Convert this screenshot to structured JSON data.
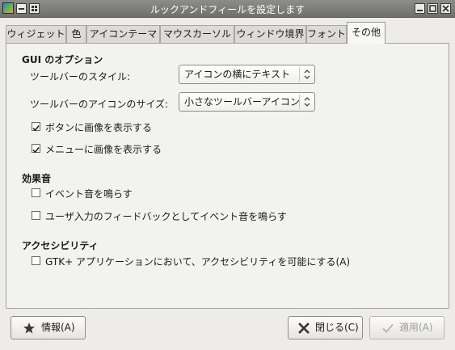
{
  "window": {
    "title": "ルックアンドフィールを設定します"
  },
  "tabs": [
    {
      "label": "ウィジェット"
    },
    {
      "label": "色"
    },
    {
      "label": "アイコンテーマ"
    },
    {
      "label": "マウスカーソル"
    },
    {
      "label": "ウィンドウ境界"
    },
    {
      "label": "フォント"
    },
    {
      "label": "その他",
      "active": true
    }
  ],
  "gui_options": {
    "heading": "GUI のオプション",
    "toolbar_style_label": "ツールバーのスタイル:",
    "toolbar_style_value": "アイコンの横にテキスト",
    "toolbar_icon_size_label": "ツールバーのアイコンのサイズ:",
    "toolbar_icon_size_value": "小さなツールバーアイコン",
    "show_button_images": {
      "label": "ボタンに画像を表示する",
      "checked": true
    },
    "show_menu_images": {
      "label": "メニューに画像を表示する",
      "checked": true
    }
  },
  "sound_effects": {
    "heading": "効果音",
    "event_sounds": {
      "label": "イベント音を鳴らす",
      "checked": false
    },
    "input_feedback_sounds": {
      "label": "ユーザ入力のフィードバックとしてイベント音を鳴らす",
      "checked": false
    }
  },
  "accessibility": {
    "heading": "アクセシビリティ",
    "enable_gtk_accessibility": {
      "label": "GTK+ アプリケーションにおいて、アクセシビリティを可能にする(A)",
      "checked": false
    }
  },
  "buttons": {
    "info": "情報(A)",
    "close": "閉じる(C)",
    "apply": "適用(A)"
  },
  "colors": {
    "titlebar": "#7b7b79",
    "panel": "#f2f2f0"
  }
}
